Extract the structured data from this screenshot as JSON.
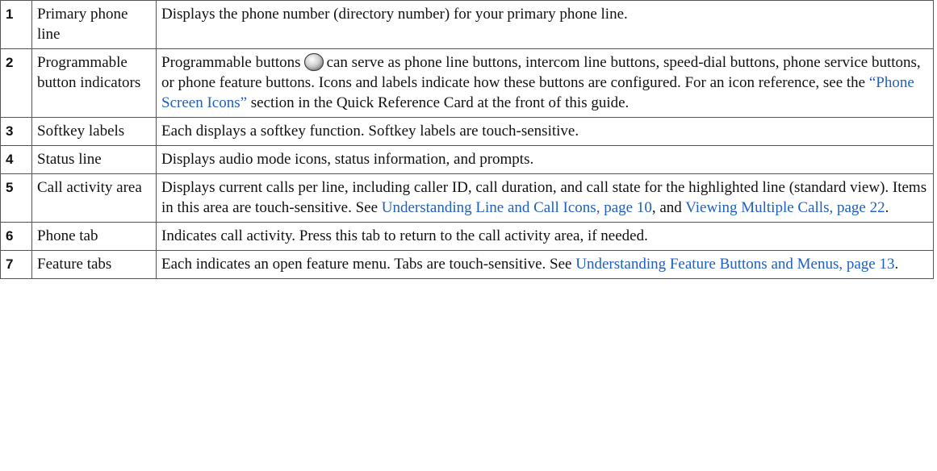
{
  "rows": [
    {
      "num": "1",
      "label": "Primary phone line",
      "desc": "Displays the phone number (directory number) for your primary phone line."
    },
    {
      "num": "2",
      "label": "Programmable button indicators",
      "desc_a": "Programmable buttons",
      "button_icon": "round-button-icon",
      "desc_b": "can serve as phone line buttons, intercom line buttons, speed-dial buttons, phone service buttons, or phone feature buttons. Icons and labels indicate how these buttons are configured. For an icon reference, see the",
      "link": "“Phone Screen Icons”",
      "desc_c": "section in the Quick Reference Card at the front of this guide."
    },
    {
      "num": "3",
      "label": "Softkey labels",
      "desc": "Each displays a softkey function. Softkey labels are touch-sensitive."
    },
    {
      "num": "4",
      "label": "Status line",
      "desc": "Displays audio mode icons, status information, and prompts."
    },
    {
      "num": "5",
      "label": "Call activity area",
      "desc_a": "Displays current calls per line, including caller ID, call duration, and call state for the highlighted line (standard view). Items in this area are touch-sensitive. See",
      "link1": "Understanding Line and Call Icons, page 10",
      "desc_b": ", and",
      "link2": "Viewing Multiple Calls, page 22",
      "desc_c": "."
    },
    {
      "num": "6",
      "label": "Phone tab",
      "desc": "Indicates call activity. Press this tab to return to the call activity area, if needed."
    },
    {
      "num": "7",
      "label": "Feature tabs",
      "desc_a": "Each indicates an open feature menu. Tabs are touch-sensitive. See",
      "link": "Understanding Feature Buttons and Menus, page 13",
      "desc_b": "."
    }
  ],
  "colors": {
    "link": "#1f5fbf",
    "border": "#555555",
    "text": "#111111"
  }
}
